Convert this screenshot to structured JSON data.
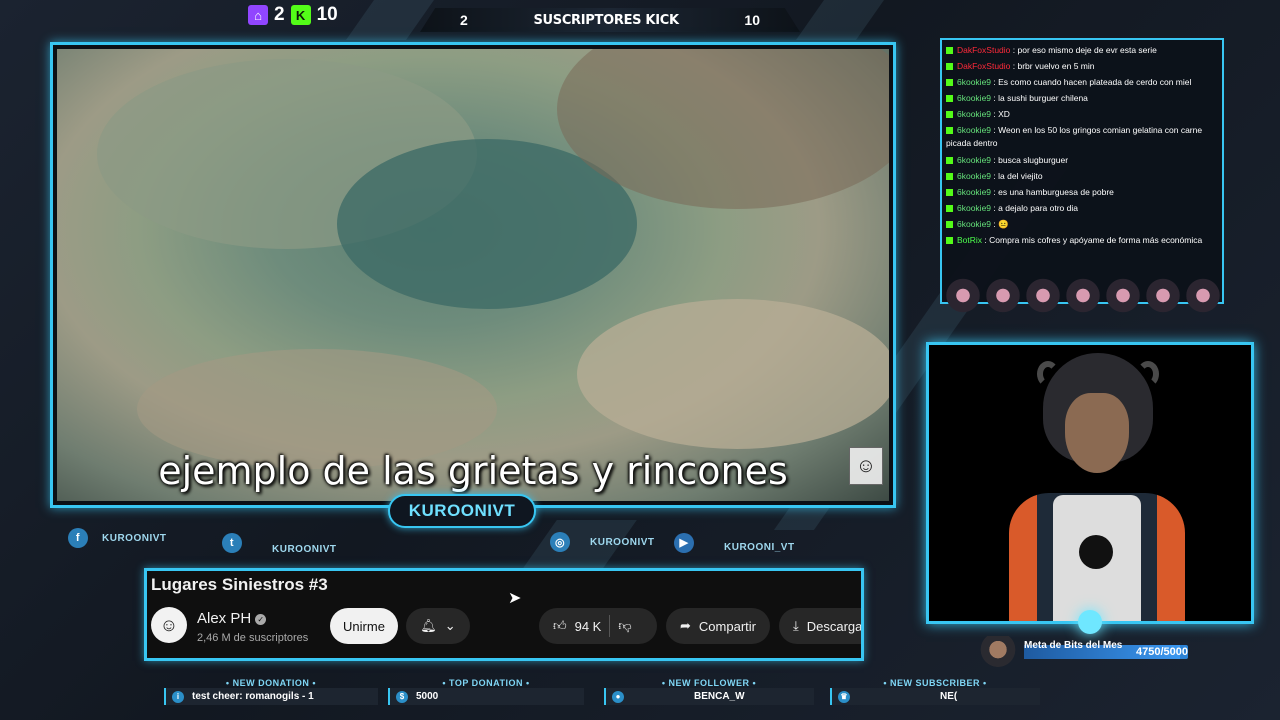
{
  "top": {
    "twitch_count": "2",
    "kick_count": "10",
    "bar_left": "2",
    "bar_title": "SUSCRIPTORES KICK",
    "bar_right": "10",
    "twitch_icon": "twitch-icon",
    "kick_icon": "kick-icon"
  },
  "video": {
    "subtitle": "ejemplo de las grietas y rincones"
  },
  "channel_pill": "KUROONIVT",
  "socials": [
    {
      "icon": "facebook-icon",
      "glyph": "f",
      "handle": "KUROONIVT"
    },
    {
      "icon": "twitter-icon",
      "glyph": "t",
      "handle": "KUROONIVT"
    },
    {
      "icon": "instagram-icon",
      "glyph": "◎",
      "handle": "KUROONIVT"
    },
    {
      "icon": "youtube-icon",
      "glyph": "▶",
      "handle": "KUROONI_VT"
    }
  ],
  "youtube": {
    "title": "Lugares Siniestros #3",
    "channel": "Alex PH",
    "subscribers": "2,46 M de suscriptores",
    "join": "Unirme",
    "likes": "94 K",
    "share": "Compartir",
    "download": "Descarga"
  },
  "alerts": [
    {
      "label": "• NEW DONATION •",
      "value": "test cheer: romanogils - 1",
      "icon": "info-icon"
    },
    {
      "label": "• TOP DONATION •",
      "value": "5000",
      "icon": "money-bag-icon"
    },
    {
      "label": "• NEW FOLLOWER •",
      "value": "BENCA_W",
      "icon": "user-icon"
    },
    {
      "label": "• NEW SUBSCRIBER •",
      "value": "NE(",
      "icon": "crown-icon"
    }
  ],
  "chat": [
    {
      "user": "DakFoxStudio",
      "cls": "u1",
      "text": ": por eso mismo deje de evr esta serie"
    },
    {
      "user": "DakFoxStudio",
      "cls": "u1",
      "text": ": brbr vuelvo en 5 min"
    },
    {
      "user": "6kookie9",
      "cls": "u2",
      "text": ": Es como cuando hacen plateada de cerdo con miel"
    },
    {
      "user": "6kookie9",
      "cls": "u2",
      "text": ": la sushi burguer chilena"
    },
    {
      "user": "6kookie9",
      "cls": "u2",
      "text": ": XD"
    },
    {
      "user": "6kookie9",
      "cls": "u2",
      "text": ": Weon en los 50 los gringos comian gelatina con carne picada dentro"
    },
    {
      "user": "6kookie9",
      "cls": "u2",
      "text": ": busca slugburguer"
    },
    {
      "user": "6kookie9",
      "cls": "u2",
      "text": ": la del viejito"
    },
    {
      "user": "6kookie9",
      "cls": "u2",
      "text": ": es una hamburguesa de pobre"
    },
    {
      "user": "6kookie9",
      "cls": "u2",
      "text": ": a dejalo para otro dia"
    },
    {
      "user": "6kookie9",
      "cls": "u2",
      "text": ": 😐"
    },
    {
      "user": "BotRix",
      "cls": "u3",
      "text": ": Compra mis cofres y apóyame de forma más económica"
    }
  ],
  "meta": {
    "label": "Meta de Bits del Mes",
    "value": "4750/5000",
    "progress": 0.95
  }
}
